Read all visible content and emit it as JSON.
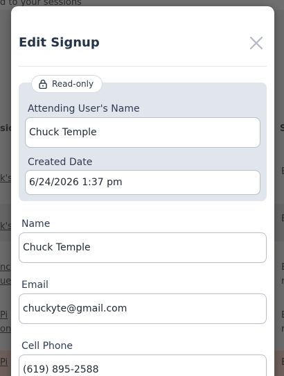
{
  "background": {
    "top_text": "d to your sessions",
    "col_left_header": "sio",
    "col_right_header": "S",
    "rows": [
      {
        "left": "k's",
        "right": "E"
      },
      {
        "left": "k's",
        "right": "E"
      },
      {
        "left": "nc",
        "right": "E"
      },
      {
        "left": "ue",
        "right": "r"
      },
      {
        "left": "Pi",
        "right": "E"
      },
      {
        "left": "on",
        "right": "r"
      },
      {
        "left": "Pi",
        "right": "E"
      }
    ]
  },
  "modal": {
    "title": "Edit Signup",
    "close_icon": "close-x-icon",
    "readonly": {
      "badge_icon": "lock-icon",
      "badge_label": "Read-only",
      "attending_user_label": "Attending User's Name",
      "attending_user_value": "Chuck Temple",
      "created_date_label": "Created Date",
      "created_date_value": "6/24/2026 1:37 pm"
    },
    "fields": {
      "name_label": "Name",
      "name_value": "Chuck Temple",
      "email_label": "Email",
      "email_value": "chuckyte@gmail.com",
      "phone_label": "Cell Phone",
      "phone_value": "(619) 895-2588"
    }
  },
  "colors": {
    "title": "#24324a",
    "readonly_bg": "#e1e5ec",
    "input_border": "#b9c0cc",
    "overlay": "#6a6a6a"
  }
}
